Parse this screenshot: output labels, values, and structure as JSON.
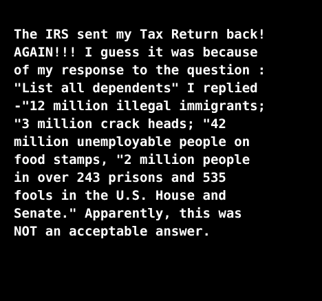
{
  "colors": {
    "background": "#000000",
    "text": "#ffffff"
  },
  "message": {
    "lines": [
      "The IRS sent my Tax Return back!",
      "AGAIN!!! I guess it was because",
      "of my response to the question :",
      "\"List all dependents\" I replied",
      "-\"12 million illegal immigrants;",
      "\"3 million crack heads; \"42",
      "million unemployable people on",
      "food stamps, \"2 million people",
      "in over 243 prisons and 535",
      "fools in the U.S. House and",
      "Senate.\" Apparently, this was",
      "NOT an acceptable answer."
    ]
  }
}
